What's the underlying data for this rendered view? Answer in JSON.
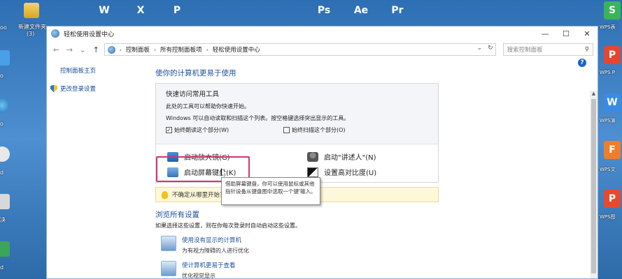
{
  "desktop": {
    "left_labels": [
      "oo",
      "新建文件夹",
      "(3)",
      "o",
      "o",
      "d",
      "决",
      "d"
    ],
    "top_icons": [
      {
        "name": "word-icon",
        "glyph": "W",
        "color": "#2b579a"
      },
      {
        "name": "excel-icon",
        "glyph": "X",
        "color": "#217346"
      },
      {
        "name": "powerpoint-icon",
        "glyph": "P",
        "color": "#d24726"
      },
      {
        "name": "photoshop-icon",
        "glyph": "Ps",
        "color": "#001e36"
      },
      {
        "name": "after-effects-icon",
        "glyph": "Ae",
        "color": "#1f0040"
      },
      {
        "name": "premiere-icon",
        "glyph": "Pr",
        "color": "#2a0634"
      }
    ],
    "right_labels": [
      "WPS表",
      "WPS P",
      "WPS演",
      "WPS文",
      "WPS图",
      "金山PD"
    ]
  },
  "window": {
    "title": "轻松使用设置中心",
    "controls": {
      "minimize": "—",
      "maximize": "☐",
      "close": "✕"
    },
    "nav": {
      "back": "←",
      "forward": "→",
      "recent": "⌄",
      "up": "↑"
    },
    "breadcrumb": [
      "控制面板",
      "所有控制面板项",
      "轻松使用设置中心"
    ],
    "search_placeholder": "搜索控制面板",
    "help": "?"
  },
  "sidebar": {
    "home": "控制面板主页",
    "logon": "更改登录设置"
  },
  "main": {
    "heading": "使你的计算机更易于使用",
    "panel": {
      "title": "快速访问常用工具",
      "line1": "此处的工具可以帮助你快速开始。",
      "line2": "Windows 可以自动读取和扫描这个列表。按空格键选择突出显示的工具。",
      "check1": "始终朗读这个部分(W)",
      "check1_checked": "✓",
      "check2": "始终扫描这个部分(O)",
      "tools": {
        "magnifier": "启动放大镜(G)",
        "narrator": "启动\"讲述人\"(N)",
        "keyboard": "启动屏幕键盘(K)",
        "contrast": "设置高对比度(U)"
      }
    },
    "tooltip": "借助屏幕键盘，你可以使用鼠标或其他指针设备从键盘图中选取一个键'输入。",
    "tip": "不确定从哪里开始？",
    "browse_title": "浏览所有设置",
    "browse_sub": "如果选择这些设置，则在你每次登录时自动启动这些设置。",
    "items": [
      {
        "link": "使用没有显示的计算机",
        "desc": "为有视力障碍的人进行优化"
      },
      {
        "link": "使计算机更易于查看",
        "desc": "优化视觉显示"
      }
    ]
  }
}
